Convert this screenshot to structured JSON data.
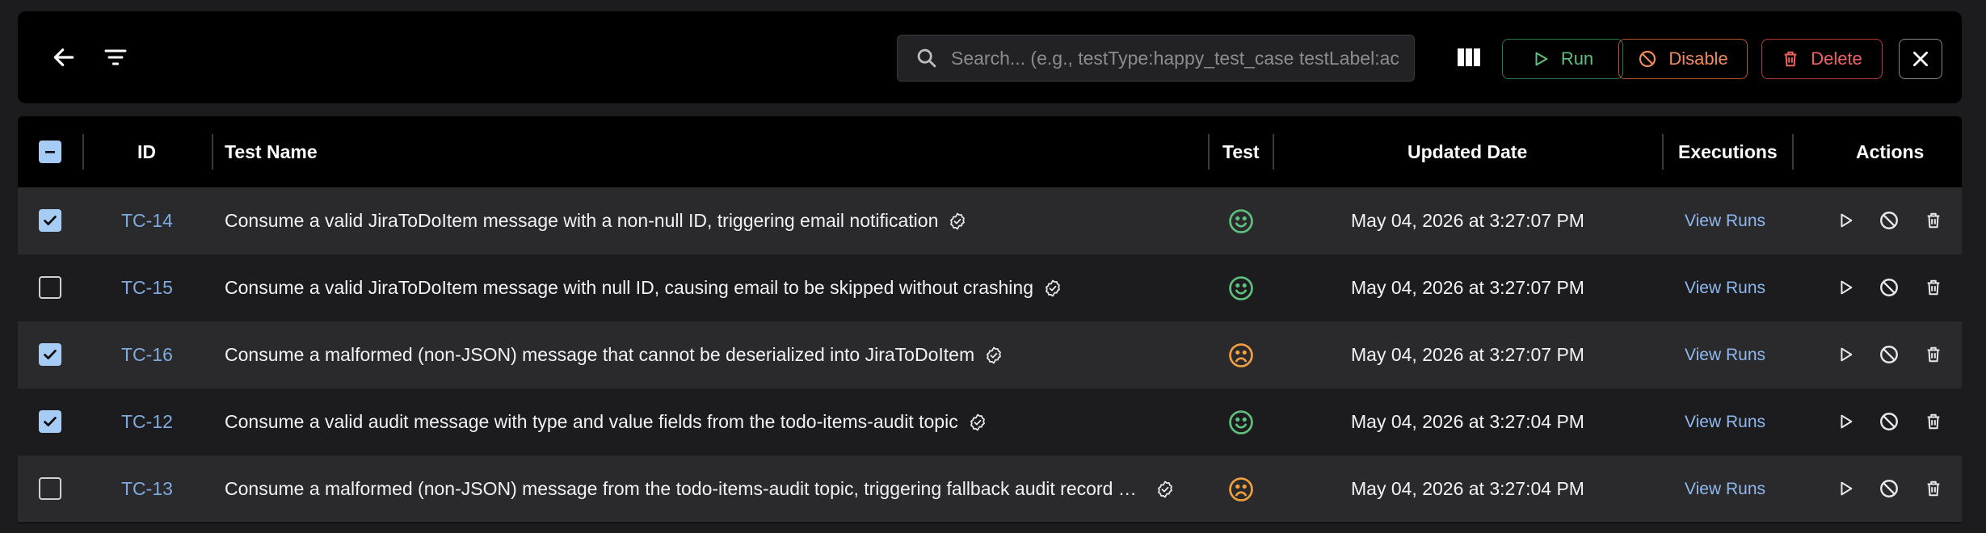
{
  "toolbar": {
    "search_placeholder": "Search... (e.g., testType:happy_test_case testLabel:ac",
    "run_label": "Run",
    "disable_label": "Disable",
    "delete_label": "Delete"
  },
  "table": {
    "headers": {
      "id": "ID",
      "test_name": "Test Name",
      "test": "Test",
      "updated_date": "Updated Date",
      "executions": "Executions",
      "actions": "Actions"
    },
    "rows": [
      {
        "checked": true,
        "id": "TC-14",
        "name": "Consume a valid JiraToDoItem message with a non-null ID, triggering email notification",
        "test_status": "happy",
        "updated": "May 04, 2026 at 3:27:07 PM",
        "executions": "View Runs"
      },
      {
        "checked": false,
        "id": "TC-15",
        "name": "Consume a valid JiraToDoItem message with null ID, causing email to be skipped without crashing",
        "test_status": "happy",
        "updated": "May 04, 2026 at 3:27:07 PM",
        "executions": "View Runs"
      },
      {
        "checked": true,
        "id": "TC-16",
        "name": "Consume a malformed (non-JSON) message that cannot be deserialized into JiraToDoItem",
        "test_status": "sad",
        "updated": "May 04, 2026 at 3:27:07 PM",
        "executions": "View Runs"
      },
      {
        "checked": true,
        "id": "TC-12",
        "name": "Consume a valid audit message with type and value fields from the todo-items-audit topic",
        "test_status": "happy",
        "updated": "May 04, 2026 at 3:27:04 PM",
        "executions": "View Runs"
      },
      {
        "checked": false,
        "id": "TC-13",
        "name": "Consume a malformed (non-JSON) message from the todo-items-audit topic, triggering fallback audit record cre…",
        "test_status": "sad",
        "updated": "May 04, 2026 at 3:27:04 PM",
        "executions": "View Runs"
      }
    ]
  },
  "colors": {
    "happy": "#5fbf7f",
    "sad": "#f0a040",
    "link": "#7fa9df",
    "run": "#5fbf7f",
    "disable": "#f08a5d",
    "delete": "#ef6262"
  }
}
